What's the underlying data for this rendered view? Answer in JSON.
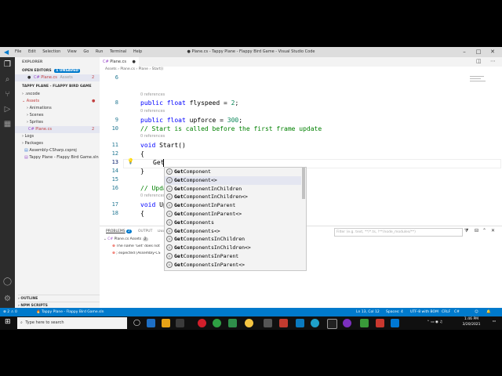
{
  "window": {
    "title": "● Plane.cs - Tappy Plane - Flappy Bird Game - Visual Studio Code",
    "menu": [
      "File",
      "Edit",
      "Selection",
      "View",
      "Go",
      "Run",
      "Terminal",
      "Help"
    ]
  },
  "sidebar": {
    "title": "EXPLORER",
    "open_editors_label": "OPEN EDITORS",
    "unsaved_badge": "1 UNSAVED",
    "open_editor_file": "Plane.cs",
    "open_editor_folder": "Assets",
    "open_editor_count": "2",
    "project_label": "TAPPY PLANE - FLAPPY BIRD GAME",
    "tree": [
      {
        "label": ".vscode",
        "indent": 1
      },
      {
        "label": "Assets",
        "indent": 1
      },
      {
        "label": "Animations",
        "indent": 2
      },
      {
        "label": "Scenes",
        "indent": 2
      },
      {
        "label": "Sprites",
        "indent": 2
      },
      {
        "label": "Plane.cs",
        "indent": 2,
        "count": "2"
      },
      {
        "label": "Logs",
        "indent": 1
      },
      {
        "label": "Packages",
        "indent": 1
      },
      {
        "label": "Assembly-CSharp.csproj",
        "indent": 1
      },
      {
        "label": "Tappy Plane - Flappy Bird Game.sln",
        "indent": 1
      }
    ],
    "outline_label": "OUTLINE",
    "npm_label": "NPM SCRIPTS"
  },
  "editor": {
    "tab_label": "Plane.cs",
    "breadcrumb": [
      "Assets",
      "Plane.cs",
      "Plane",
      "Start()"
    ],
    "references_text": "0 references",
    "lines": {
      "l6": "6",
      "l8": "8",
      "l8_code_kw": "public float ",
      "l8_code_rest": "flyspeed = ",
      "l8_num": "2",
      "l8_end": ";",
      "l9": "9",
      "l9_code_kw": "public float ",
      "l9_code_rest": "upforce = ",
      "l9_num": "300",
      "l9_end": ";",
      "l10": "10",
      "l10_comment": "// Start is called before the first frame update",
      "l11": "11",
      "l11_kw": "void ",
      "l11_rest": "Start()",
      "l12": "12",
      "l12_code": "{",
      "l13": "13",
      "l13_code": "Get",
      "l14": "14",
      "l14_code": "}",
      "l15": "15",
      "l16": "16",
      "l16_comment": "// Upda",
      "l17": "17",
      "l17_kw": "void ",
      "l17_rest": "Up",
      "l18": "18",
      "l18_code": "{"
    }
  },
  "suggestions": [
    {
      "match": "Get",
      "rest": "Component"
    },
    {
      "match": "Get",
      "rest": "Component<>"
    },
    {
      "match": "Get",
      "rest": "ComponentInChildren"
    },
    {
      "match": "Get",
      "rest": "ComponentInChildren<>"
    },
    {
      "match": "Get",
      "rest": "ComponentInParent"
    },
    {
      "match": "Get",
      "rest": "ComponentInParent<>"
    },
    {
      "match": "Get",
      "rest": "Components"
    },
    {
      "match": "Get",
      "rest": "Components<>"
    },
    {
      "match": "Get",
      "rest": "ComponentsInChildren"
    },
    {
      "match": "Get",
      "rest": "ComponentsInChildren<>"
    },
    {
      "match": "Get",
      "rest": "ComponentsInParent"
    },
    {
      "match": "Get",
      "rest": "ComponentsInParent<>"
    }
  ],
  "panel": {
    "tabs": [
      "PROBLEMS",
      "OUTPUT",
      "DEBUG CONSOLE"
    ],
    "problems_count": "2",
    "filter_placeholder": "Filter (e.g. text, **/*.ts, !**/node_modules/**)",
    "file_row": "Plane.cs  Assets",
    "file_count": "2",
    "errors": [
      "The name 'Get' does not",
      "; expected [Assembly-CS"
    ]
  },
  "statusbar": {
    "errors": "2",
    "warnings": "0",
    "project": "Tappy Plane - Flappy Bird Game.sln",
    "position": "Ln 13, Col 12",
    "spaces": "Spaces: 4",
    "encoding": "UTF-8 with BOM",
    "eol": "CRLF",
    "language": "C#"
  },
  "taskbar": {
    "search_placeholder": "Type here to search",
    "time": "1:46 PM",
    "date": "3/20/2021"
  }
}
